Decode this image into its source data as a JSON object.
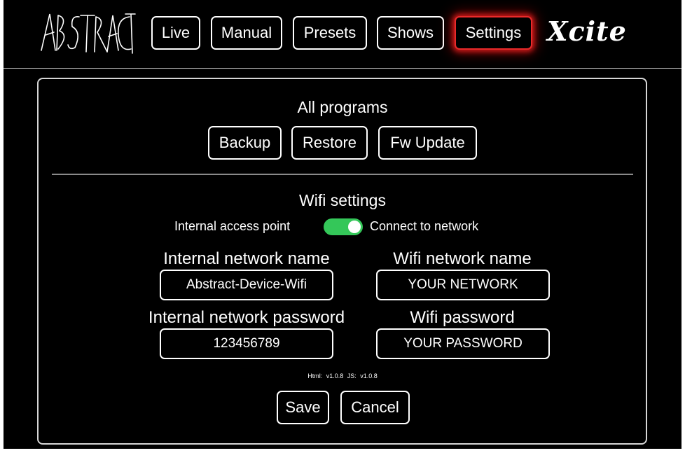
{
  "nav": {
    "logo_text": "ABSTRACT",
    "items": [
      {
        "label": "Live"
      },
      {
        "label": "Manual"
      },
      {
        "label": "Presets"
      },
      {
        "label": "Shows"
      },
      {
        "label": "Settings",
        "active": true
      }
    ],
    "brand": "Xcite"
  },
  "programs": {
    "title": "All programs",
    "buttons": {
      "backup": "Backup",
      "restore": "Restore",
      "fw_update": "Fw Update"
    }
  },
  "wifi": {
    "title": "Wifi settings",
    "mode_left_label": "Internal access point",
    "mode_right_label": "Connect to network",
    "toggle_on": true,
    "internal_name_label": "Internal network name",
    "internal_name_value": "Abstract-Device-Wifi",
    "wifi_name_label": "Wifi network name",
    "wifi_name_value": "YOUR NETWORK",
    "internal_password_label": "Internal network password",
    "internal_password_value": "123456789",
    "wifi_password_label": "Wifi password",
    "wifi_password_value": "YOUR PASSWORD"
  },
  "version": {
    "html": "Html: v1.0.8",
    "js": "JS: v1.0.8"
  },
  "actions": {
    "save": "Save",
    "cancel": "Cancel"
  },
  "colors": {
    "active_glow": "#e82a2a",
    "toggle_on": "#34c759",
    "background": "#000000"
  }
}
